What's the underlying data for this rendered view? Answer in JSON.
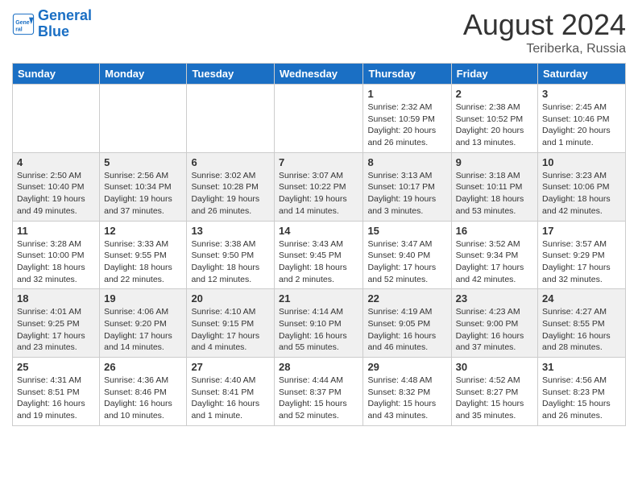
{
  "header": {
    "logo_line1": "General",
    "logo_line2": "Blue",
    "month_year": "August 2024",
    "location": "Teriberka, Russia"
  },
  "weekdays": [
    "Sunday",
    "Monday",
    "Tuesday",
    "Wednesday",
    "Thursday",
    "Friday",
    "Saturday"
  ],
  "rows": [
    [
      {
        "day": "",
        "info": ""
      },
      {
        "day": "",
        "info": ""
      },
      {
        "day": "",
        "info": ""
      },
      {
        "day": "",
        "info": ""
      },
      {
        "day": "1",
        "info": "Sunrise: 2:32 AM\nSunset: 10:59 PM\nDaylight: 20 hours\nand 26 minutes."
      },
      {
        "day": "2",
        "info": "Sunrise: 2:38 AM\nSunset: 10:52 PM\nDaylight: 20 hours\nand 13 minutes."
      },
      {
        "day": "3",
        "info": "Sunrise: 2:45 AM\nSunset: 10:46 PM\nDaylight: 20 hours\nand 1 minute."
      }
    ],
    [
      {
        "day": "4",
        "info": "Sunrise: 2:50 AM\nSunset: 10:40 PM\nDaylight: 19 hours\nand 49 minutes."
      },
      {
        "day": "5",
        "info": "Sunrise: 2:56 AM\nSunset: 10:34 PM\nDaylight: 19 hours\nand 37 minutes."
      },
      {
        "day": "6",
        "info": "Sunrise: 3:02 AM\nSunset: 10:28 PM\nDaylight: 19 hours\nand 26 minutes."
      },
      {
        "day": "7",
        "info": "Sunrise: 3:07 AM\nSunset: 10:22 PM\nDaylight: 19 hours\nand 14 minutes."
      },
      {
        "day": "8",
        "info": "Sunrise: 3:13 AM\nSunset: 10:17 PM\nDaylight: 19 hours\nand 3 minutes."
      },
      {
        "day": "9",
        "info": "Sunrise: 3:18 AM\nSunset: 10:11 PM\nDaylight: 18 hours\nand 53 minutes."
      },
      {
        "day": "10",
        "info": "Sunrise: 3:23 AM\nSunset: 10:06 PM\nDaylight: 18 hours\nand 42 minutes."
      }
    ],
    [
      {
        "day": "11",
        "info": "Sunrise: 3:28 AM\nSunset: 10:00 PM\nDaylight: 18 hours\nand 32 minutes."
      },
      {
        "day": "12",
        "info": "Sunrise: 3:33 AM\nSunset: 9:55 PM\nDaylight: 18 hours\nand 22 minutes."
      },
      {
        "day": "13",
        "info": "Sunrise: 3:38 AM\nSunset: 9:50 PM\nDaylight: 18 hours\nand 12 minutes."
      },
      {
        "day": "14",
        "info": "Sunrise: 3:43 AM\nSunset: 9:45 PM\nDaylight: 18 hours\nand 2 minutes."
      },
      {
        "day": "15",
        "info": "Sunrise: 3:47 AM\nSunset: 9:40 PM\nDaylight: 17 hours\nand 52 minutes."
      },
      {
        "day": "16",
        "info": "Sunrise: 3:52 AM\nSunset: 9:34 PM\nDaylight: 17 hours\nand 42 minutes."
      },
      {
        "day": "17",
        "info": "Sunrise: 3:57 AM\nSunset: 9:29 PM\nDaylight: 17 hours\nand 32 minutes."
      }
    ],
    [
      {
        "day": "18",
        "info": "Sunrise: 4:01 AM\nSunset: 9:25 PM\nDaylight: 17 hours\nand 23 minutes."
      },
      {
        "day": "19",
        "info": "Sunrise: 4:06 AM\nSunset: 9:20 PM\nDaylight: 17 hours\nand 14 minutes."
      },
      {
        "day": "20",
        "info": "Sunrise: 4:10 AM\nSunset: 9:15 PM\nDaylight: 17 hours\nand 4 minutes."
      },
      {
        "day": "21",
        "info": "Sunrise: 4:14 AM\nSunset: 9:10 PM\nDaylight: 16 hours\nand 55 minutes."
      },
      {
        "day": "22",
        "info": "Sunrise: 4:19 AM\nSunset: 9:05 PM\nDaylight: 16 hours\nand 46 minutes."
      },
      {
        "day": "23",
        "info": "Sunrise: 4:23 AM\nSunset: 9:00 PM\nDaylight: 16 hours\nand 37 minutes."
      },
      {
        "day": "24",
        "info": "Sunrise: 4:27 AM\nSunset: 8:55 PM\nDaylight: 16 hours\nand 28 minutes."
      }
    ],
    [
      {
        "day": "25",
        "info": "Sunrise: 4:31 AM\nSunset: 8:51 PM\nDaylight: 16 hours\nand 19 minutes."
      },
      {
        "day": "26",
        "info": "Sunrise: 4:36 AM\nSunset: 8:46 PM\nDaylight: 16 hours\nand 10 minutes."
      },
      {
        "day": "27",
        "info": "Sunrise: 4:40 AM\nSunset: 8:41 PM\nDaylight: 16 hours\nand 1 minute."
      },
      {
        "day": "28",
        "info": "Sunrise: 4:44 AM\nSunset: 8:37 PM\nDaylight: 15 hours\nand 52 minutes."
      },
      {
        "day": "29",
        "info": "Sunrise: 4:48 AM\nSunset: 8:32 PM\nDaylight: 15 hours\nand 43 minutes."
      },
      {
        "day": "30",
        "info": "Sunrise: 4:52 AM\nSunset: 8:27 PM\nDaylight: 15 hours\nand 35 minutes."
      },
      {
        "day": "31",
        "info": "Sunrise: 4:56 AM\nSunset: 8:23 PM\nDaylight: 15 hours\nand 26 minutes."
      }
    ]
  ]
}
